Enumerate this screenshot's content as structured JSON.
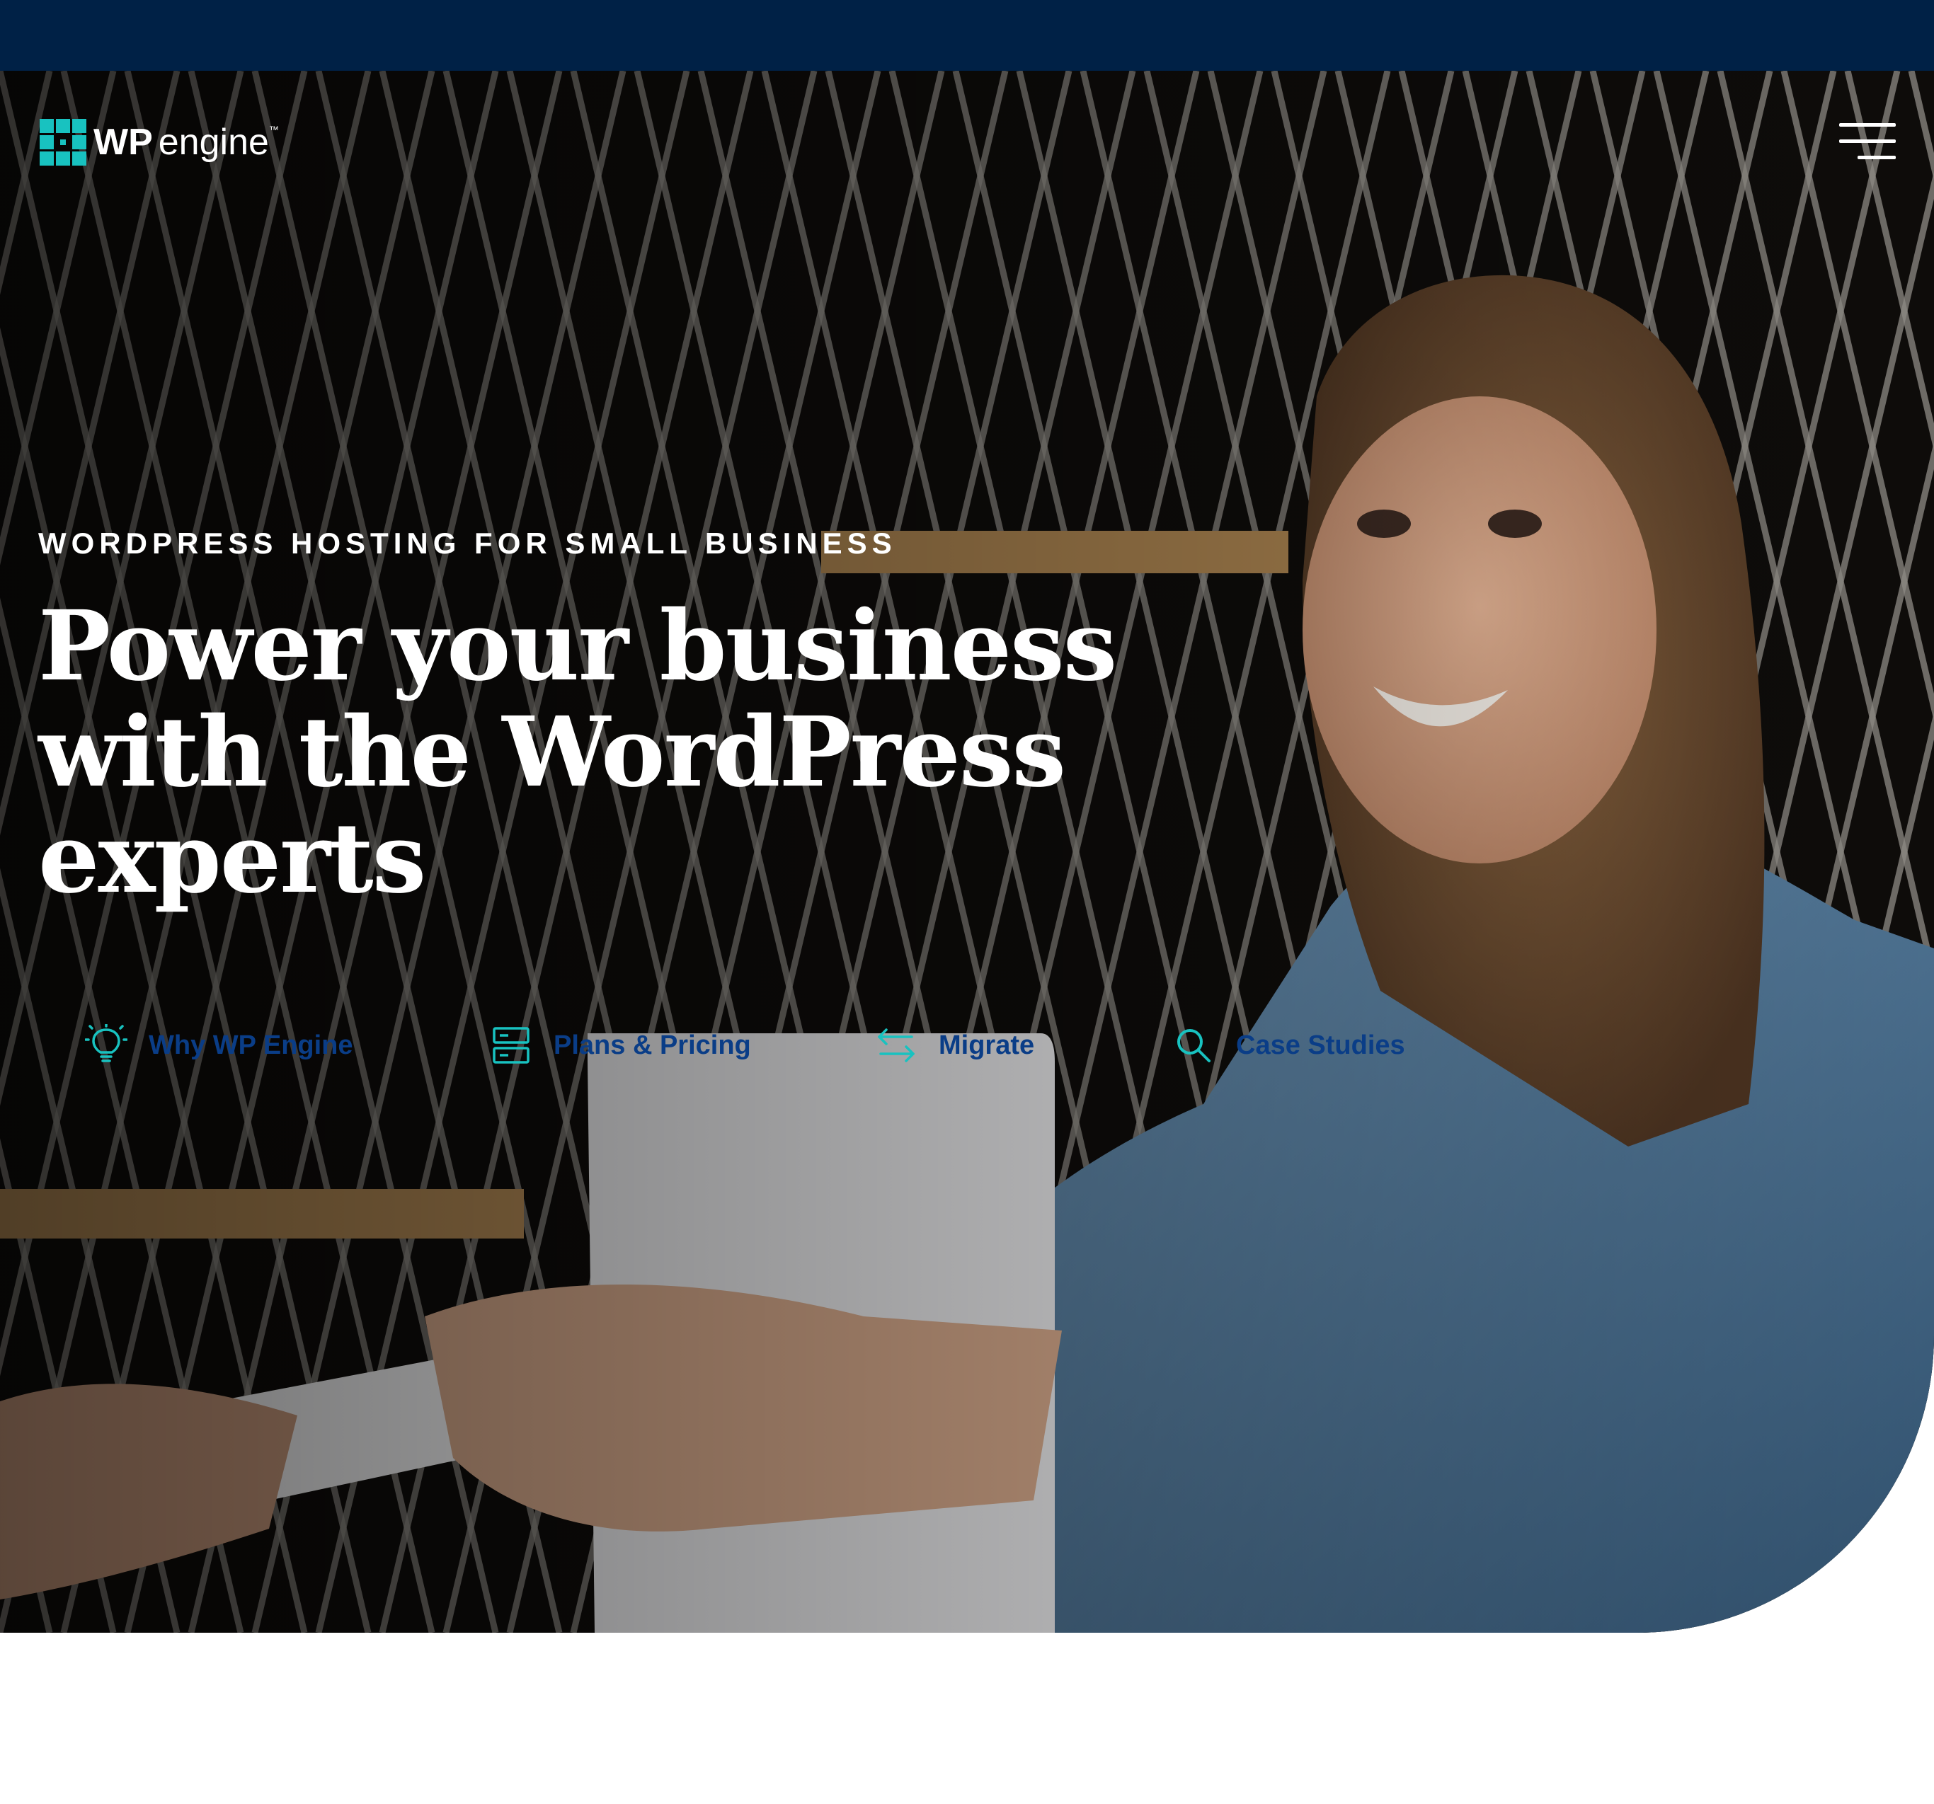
{
  "brand": {
    "name_bold": "WP",
    "name_light": "engine",
    "trademark": "™",
    "colors": {
      "top_band": "#002146",
      "accent": "#18c2c0",
      "link_text": "#0a3d87"
    }
  },
  "header": {
    "menu_icon": "hamburger-menu-icon"
  },
  "hero": {
    "eyebrow": "WORDPRESS HOSTING FOR SMALL BUSINESS",
    "headline": "Power your business with the WordPress experts"
  },
  "quick_links": [
    {
      "label": "Why WP Engine",
      "icon": "lightbulb-icon"
    },
    {
      "label": "Plans & Pricing",
      "icon": "server-icon"
    },
    {
      "label": "Migrate",
      "icon": "swap-arrows-icon"
    },
    {
      "label": "Case Studies",
      "icon": "search-icon"
    }
  ]
}
